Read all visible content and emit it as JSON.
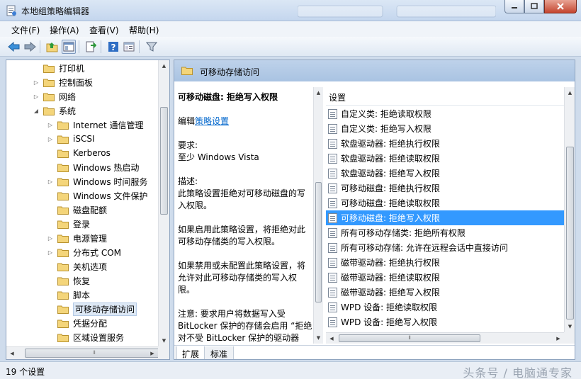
{
  "window": {
    "title": "本地组策略编辑器"
  },
  "menu": [
    "文件(F)",
    "操作(A)",
    "查看(V)",
    "帮助(H)"
  ],
  "toolbar": [
    "back-icon",
    "forward-icon",
    "up-folder-icon",
    "show-hide-tree-icon",
    "export-icon",
    "help-icon",
    "properties-icon",
    "filter-icon"
  ],
  "tree": {
    "items": [
      {
        "label": "打印机",
        "level": 1,
        "expander": ""
      },
      {
        "label": "控制面板",
        "level": 1,
        "expander": "▷"
      },
      {
        "label": "网络",
        "level": 1,
        "expander": "▷"
      },
      {
        "label": "系统",
        "level": 1,
        "expander": "◢"
      },
      {
        "label": "Internet 通信管理",
        "level": 2,
        "expander": "▷"
      },
      {
        "label": "iSCSI",
        "level": 2,
        "expander": "▷"
      },
      {
        "label": "Kerberos",
        "level": 2,
        "expander": ""
      },
      {
        "label": "Windows 热启动",
        "level": 2,
        "expander": ""
      },
      {
        "label": "Windows 时间服务",
        "level": 2,
        "expander": "▷"
      },
      {
        "label": "Windows 文件保护",
        "level": 2,
        "expander": ""
      },
      {
        "label": "磁盘配额",
        "level": 2,
        "expander": ""
      },
      {
        "label": "登录",
        "level": 2,
        "expander": ""
      },
      {
        "label": "电源管理",
        "level": 2,
        "expander": "▷"
      },
      {
        "label": "分布式 COM",
        "level": 2,
        "expander": "▷"
      },
      {
        "label": "关机选项",
        "level": 2,
        "expander": ""
      },
      {
        "label": "恢复",
        "level": 2,
        "expander": ""
      },
      {
        "label": "脚本",
        "level": 2,
        "expander": ""
      },
      {
        "label": "可移动存储访问",
        "level": 2,
        "expander": "",
        "selected": true
      },
      {
        "label": "凭据分配",
        "level": 2,
        "expander": ""
      },
      {
        "label": "区域设置服务",
        "level": 2,
        "expander": ""
      }
    ]
  },
  "header": {
    "title": "可移动存储访问"
  },
  "description": {
    "policy_name": "可移动磁盘: 拒绝写入权限",
    "edit_prefix": "编辑",
    "edit_link": "策略设置",
    "requirements_label": "要求:",
    "requirements": "至少 Windows Vista",
    "description_label": "描述:",
    "description_text": "此策略设置拒绝对可移动磁盘的写入权限。",
    "enabled_text": "如果启用此策略设置，将拒绝对此可移动存储类的写入权限。",
    "disabled_text": "如果禁用或未配置此策略设置，将允许对此可移动存储类的写入权限。",
    "note_text": "注意: 要求用户将数据写入受 BitLocker 保护的存储会启用 “拒绝对不受 BitLocker 保护的驱动器"
  },
  "settings_list": {
    "column": "设置",
    "rows": [
      "自定义类: 拒绝读取权限",
      "自定义类: 拒绝写入权限",
      "软盘驱动器: 拒绝执行权限",
      "软盘驱动器: 拒绝读取权限",
      "软盘驱动器: 拒绝写入权限",
      "可移动磁盘: 拒绝执行权限",
      "可移动磁盘: 拒绝读取权限",
      "可移动磁盘: 拒绝写入权限",
      "所有可移动存储类: 拒绝所有权限",
      "所有可移动存储: 允许在远程会话中直接访问",
      "磁带驱动器: 拒绝执行权限",
      "磁带驱动器: 拒绝读取权限",
      "磁带驱动器: 拒绝写入权限",
      "WPD 设备: 拒绝读取权限",
      "WPD 设备: 拒绝写入权限"
    ],
    "selected_index": 7
  },
  "tabs": [
    "扩展",
    "标准"
  ],
  "status": {
    "text": "19 个设置"
  },
  "watermark": "头条号 / 电脑通专家",
  "colors": {
    "selection": "#3399ff",
    "header": "#bed2ea",
    "link": "#0066cc"
  }
}
